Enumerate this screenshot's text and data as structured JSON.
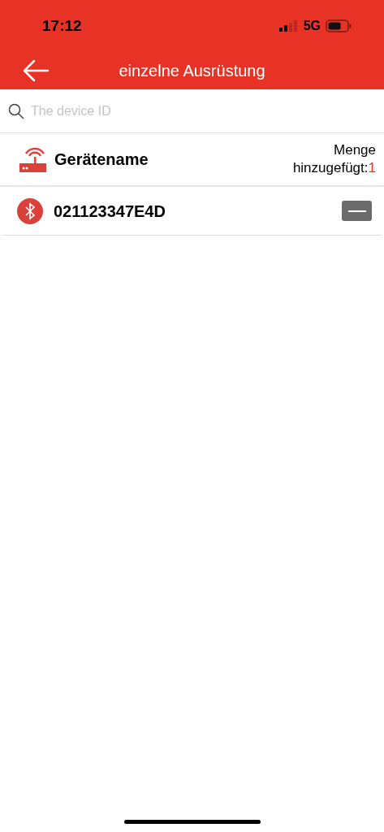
{
  "status_bar": {
    "time": "17:12",
    "network": "5G"
  },
  "nav": {
    "title": "einzelne Ausrüstung"
  },
  "search": {
    "placeholder": "The device ID"
  },
  "header": {
    "name_label": "Gerätename",
    "count_label_1": "Menge",
    "count_label_2": "hinzugefügt:",
    "count": "1"
  },
  "devices": [
    {
      "id": "021123347E4D"
    }
  ]
}
